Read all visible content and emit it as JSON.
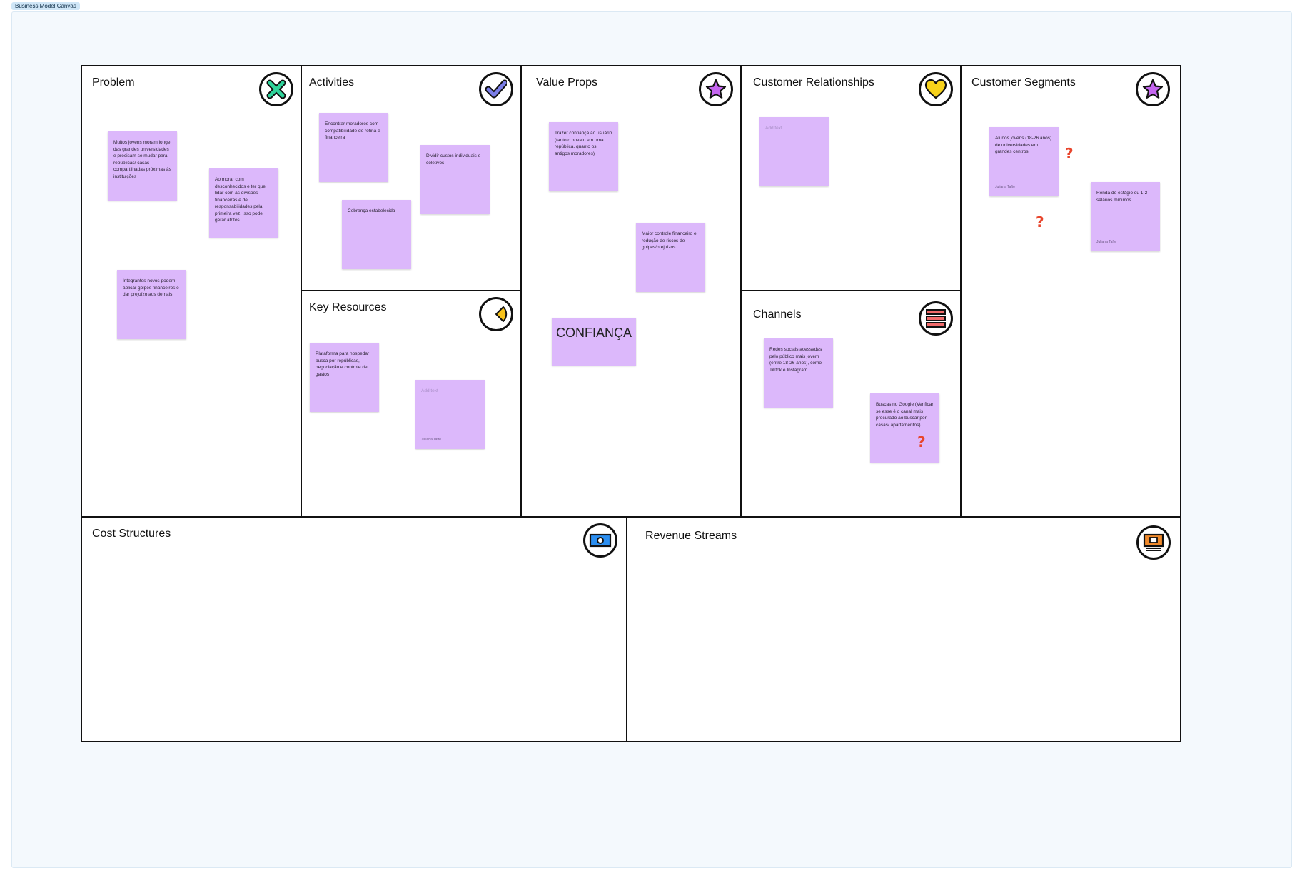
{
  "frame": {
    "label": "Business Model Canvas"
  },
  "sections": {
    "problem": {
      "title": "Problem",
      "icon": "x-mark-icon"
    },
    "activities": {
      "title": "Activities",
      "icon": "checkmark-icon"
    },
    "value_props": {
      "title": "Value Props",
      "icon": "star-icon"
    },
    "customer_relationships": {
      "title": "Customer Relationships",
      "icon": "heart-icon"
    },
    "customer_segments": {
      "title": "Customer Segments",
      "icon": "star-icon"
    },
    "key_resources": {
      "title": "Key Resources",
      "icon": "pie-chart-icon"
    },
    "channels": {
      "title": "Channels",
      "icon": "stacked-bars-icon"
    },
    "cost_structures": {
      "title": "Cost Structures",
      "icon": "banknote-icon"
    },
    "revenue_streams": {
      "title": "Revenue Streams",
      "icon": "money-screen-icon"
    }
  },
  "notes": {
    "problem_1": "Muitos jovens moram longe das grandes universidades e precisam se mudar para repúblicas/ casas compartilhadas próximas às instituições",
    "problem_2": "Ao morar com desconhecidos e ter que lidar com as divisões financeiras e de responsabilidades pela primeira vez, isso pode gerar atritos",
    "problem_3": "Integrantes novos podem aplicar golpes financeiros e dar prejuízo aos demais",
    "activities_1": "Encontrar moradores com compatibilidade de rotina e financeira",
    "activities_2": "Dividir custos individuais e coletivos",
    "activities_3": "Cobrança estabelecida",
    "key_resources_1": "Plataforma para hospedar busca por repúblicas, negociação e controle de gastos",
    "key_resources_2_placeholder": "Add text",
    "key_resources_2_author": "Juliana Tafte",
    "value_props_1": "Trazer confiança ao usuário (tanto o novato em uma república, quanto os antigos moradores)",
    "value_props_2": "Maior controle financeiro e redução de riscos de golpes/prejuízos",
    "value_props_3": "CONFIANÇA",
    "customer_relationships_1_placeholder": "Add text",
    "channels_1": "Redes sociais acessadas pelo público mais jovem (entre 18-26 anos), como Tiktok e Instagram",
    "channels_2": "Buscas no Google (Verificar se esse é o canal mais procurado ao buscar por casas/ apartamentos)",
    "customer_segments_1": "Alunos jovens (18-26 anos) de universidades em grandes centros",
    "customer_segments_1_author": "Juliana Tafte",
    "customer_segments_2": "Renda de estágio ou 1-2 salários mínimos",
    "customer_segments_2_author": "Juliana Tafte"
  },
  "markers": {
    "question": "?"
  },
  "colors": {
    "sticky_note": "#dcb8fb",
    "frame_bg": "#f4f9fd",
    "question_mark": "#e8452c",
    "x_icon": "#2fd39a",
    "check_icon": "#7b7ee8",
    "star_icon": "#c566f0",
    "heart_icon": "#f7d21b",
    "pie_icon": "#f7c21b",
    "bars_icon": "#f06a6a",
    "banknote_icon": "#2b8ef0",
    "money_screen_icon": "#f08a2c"
  }
}
